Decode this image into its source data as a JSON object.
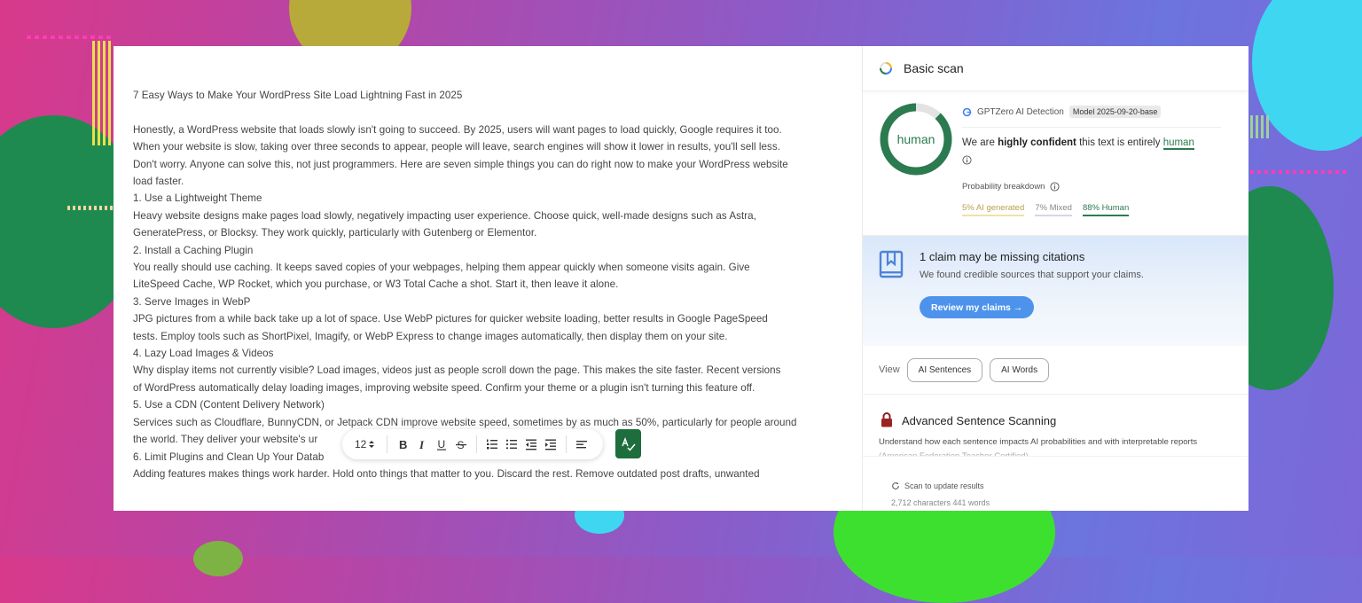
{
  "document": {
    "paragraphs": [
      "7 Easy Ways to Make Your WordPress Site Load Lightning Fast in 2025",
      "",
      "Honestly, a WordPress website that loads slowly isn't going to succeed. By 2025, users will want pages to load quickly, Google requires it too.",
      "When your website is slow, taking over three seconds to appear, people will leave, search engines will show it lower in results, you'll sell less.",
      "Don't worry. Anyone can solve this, not just programmers. Here are seven simple things you can do right now to make your WordPress website",
      "load faster.",
      "1. Use a Lightweight Theme",
      "Heavy website designs make pages load slowly, negatively impacting user experience. Choose quick, well-made designs such as Astra,",
      "GeneratePress, or Blocksy. They work quickly, particularly with Gutenberg or Elementor.",
      "2. Install a Caching Plugin",
      "You really should use caching. It keeps saved copies of your webpages, helping them appear quickly when someone visits again. Give",
      "LiteSpeed Cache, WP Rocket, which you purchase, or W3 Total Cache a shot. Start it, then leave it alone.",
      "3. Serve Images in WebP",
      "JPG pictures from a while back take up a lot of space. Use WebP pictures for quicker website loading, better results in Google PageSpeed",
      "tests. Employ tools such as ShortPixel, Imagify, or WebP Express to change images automatically, then display them on your site.",
      "4. Lazy Load Images & Videos",
      "Why display items not currently visible? Load images, videos just as people scroll down the page. This makes the site faster. Recent versions",
      "of WordPress automatically delay loading images, improving website speed. Confirm your theme or a plugin isn't turning this feature off.",
      "5. Use a CDN (Content Delivery Network)",
      "Services such as Cloudflare, BunnyCDN, or Jetpack CDN improve website speed, sometimes by as much as 50%, particularly for people around",
      "the world. They deliver your website's ur",
      "6. Limit Plugins and Clean Up Your Datab",
      "Adding features makes things work harder. Hold onto things that matter to you. Discard the rest. Remove outdated post drafts, unwanted"
    ]
  },
  "toolbar": {
    "font_size": "12",
    "buttons": [
      "bold-icon",
      "italic-icon",
      "underline-icon",
      "strikethrough-icon",
      "ordered-list-icon",
      "bullet-list-icon",
      "outdent-icon",
      "indent-icon",
      "align-left-icon"
    ]
  },
  "panel": {
    "header_title": "Basic scan",
    "result_label": "human",
    "human_fraction": 0.88,
    "detector_name": "GPTZero AI Detection",
    "model_badge": "Model 2025-09-20-base",
    "verdict_prefix": "We are",
    "verdict_bold": "highly confident",
    "verdict_middle": "this text is entirely",
    "verdict_label": "human",
    "probability_title": "Probability breakdown",
    "prob_ai": "5% AI generated",
    "prob_mixed": "7% Mixed",
    "prob_human": "88% Human",
    "claims_title": "1 claim may be missing citations",
    "claims_sub": "We found credible sources that support your claims.",
    "review_button": "Review my claims →",
    "view_label": "View",
    "view_ai_sentences": "AI Sentences",
    "view_ai_words": "AI Words",
    "adv_title": "Advanced Sentence Scanning",
    "adv_desc": "Understand how each sentence impacts AI probabilities and with interpretable reports (American Federation Teacher Certified)",
    "scan_update": "Scan to update results",
    "counts": "2,712 characters 441 words"
  },
  "colors": {
    "human_green": "#2c7a4f",
    "button_blue": "#4d93ec",
    "check_button": "#1e6d3c"
  }
}
